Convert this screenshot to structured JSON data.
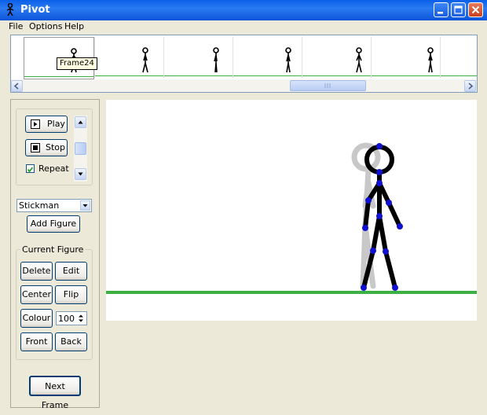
{
  "window": {
    "title": "Pivot"
  },
  "menu": {
    "file": "File",
    "options": "Options",
    "help": "Help"
  },
  "timeline": {
    "tooltip": "Frame24"
  },
  "playback": {
    "play_label": "Play",
    "stop_label": "Stop",
    "repeat_label": "Repeat",
    "repeat_checked": true
  },
  "figure_select": {
    "selected": "Stickman",
    "add_label": "Add Figure"
  },
  "current_figure": {
    "group_label": "Current Figure",
    "delete_label": "Delete",
    "edit_label": "Edit",
    "center_label": "Center",
    "flip_label": "Flip",
    "colour_label": "Colour",
    "size_value": "100",
    "front_label": "Front",
    "back_label": "Back"
  },
  "next_frame_label": "Next Frame",
  "colors": {
    "ground": "#3cb043",
    "handle": "#1010d0",
    "onion": "#c8c8c8",
    "titlebar": "#0a5fe8"
  }
}
